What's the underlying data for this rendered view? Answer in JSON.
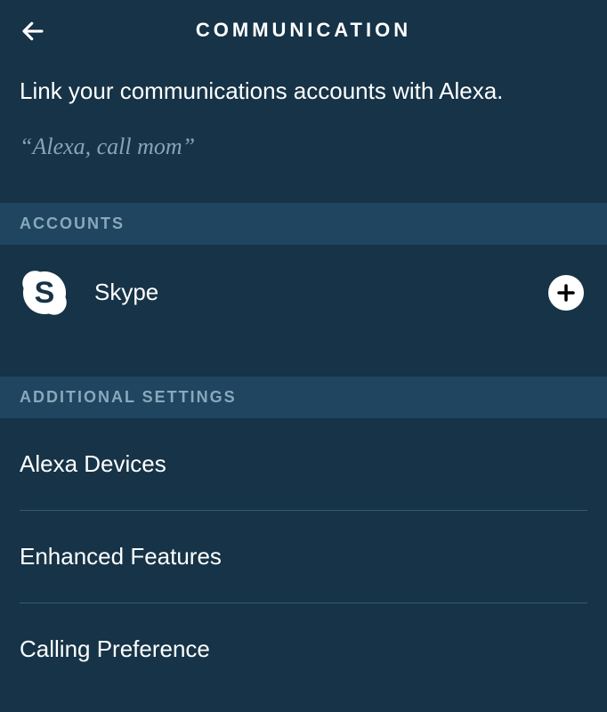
{
  "header": {
    "title": "COMMUNICATION"
  },
  "page": {
    "subtitle": "Link your communications accounts with Alexa.",
    "example_phrase": "“Alexa, call mom”"
  },
  "sections": {
    "accounts": {
      "header": "ACCOUNTS",
      "items": [
        {
          "label": "Skype",
          "icon": "skype-icon"
        }
      ]
    },
    "additional": {
      "header": "ADDITIONAL SETTINGS",
      "items": [
        {
          "label": "Alexa Devices"
        },
        {
          "label": "Enhanced Features"
        },
        {
          "label": "Calling Preference"
        }
      ]
    }
  }
}
